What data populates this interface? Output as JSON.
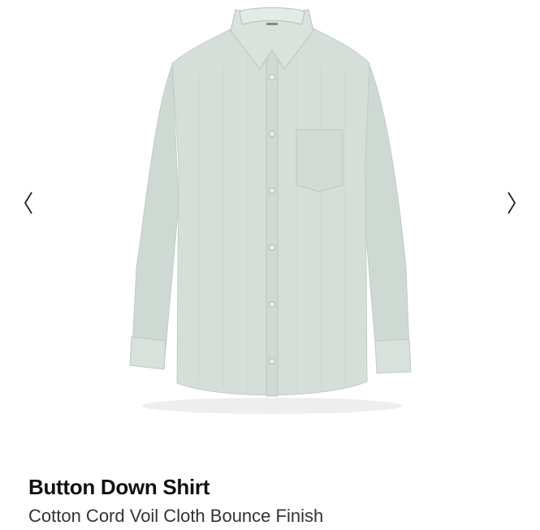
{
  "gallery": {
    "image_icon": "button-down-shirt-image",
    "prev_icon": "chevron-left-icon",
    "next_icon": "chevron-right-icon"
  },
  "product": {
    "title": "Button Down Shirt",
    "subtitle": "Cotton Cord Voil Cloth Bounce Finish"
  },
  "colors": {
    "shirt": "#d5ded8",
    "shirt_shadow": "#bcc8c1",
    "title": "#111111",
    "subtitle": "#333333",
    "arrow": "#222222"
  }
}
